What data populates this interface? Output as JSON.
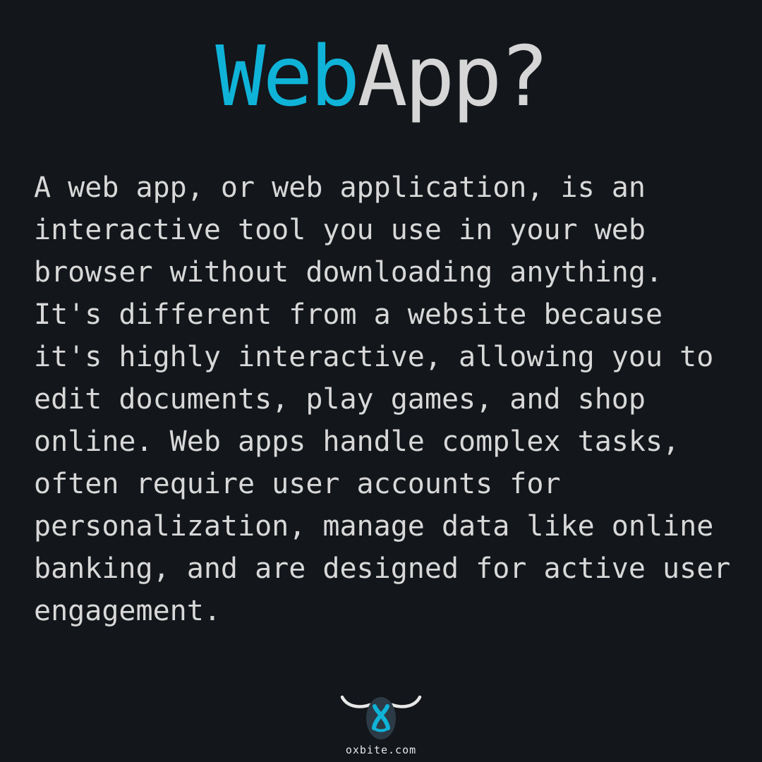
{
  "title": {
    "accent": "Web",
    "rest": "App?"
  },
  "body": {
    "lines": [
      "A web app, or web application, is an",
      "interactive tool you use in your web",
      "browser without downloading anything.",
      "It's different from a website because",
      "it's highly interactive, allowing you to",
      "edit documents, play games, and shop",
      "online. Web apps handle complex tasks,",
      "often require user accounts for",
      "personalization, manage data like online",
      "banking, and are designed for active user",
      "engagement."
    ]
  },
  "footer": {
    "logo_icon": "ox-head-logo-icon",
    "site": "oxbite.com"
  },
  "colors": {
    "background": "#13161b",
    "accent": "#0fb3d8",
    "text": "#d8d8d8"
  }
}
